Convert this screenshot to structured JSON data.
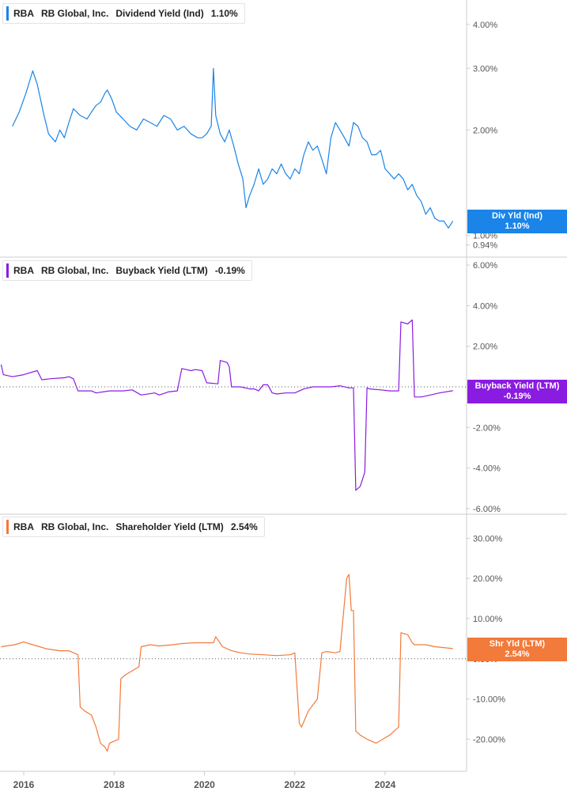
{
  "x_axis": {
    "ticks": [
      "2016",
      "2018",
      "2020",
      "2022",
      "2024"
    ]
  },
  "colors": {
    "dividend": "#1a84e8",
    "buyback": "#8a1be0",
    "shareholder": "#f27a3a",
    "axis_text": "#555555",
    "grid": "#cccccc"
  },
  "chart_data": [
    {
      "type": "line",
      "id": "dividend",
      "legend": {
        "ticker": "RBA",
        "company": "RB Global, Inc.",
        "metric": "Dividend Yield (Ind)",
        "value": "1.10%"
      },
      "tag": {
        "label": "Div Yld (Ind)",
        "value": "1.10%"
      },
      "y_scale": "log",
      "ylim": [
        0.9,
        4.6
      ],
      "y_ticks": [
        "4.00%",
        "3.00%",
        "2.00%",
        "1.00%",
        "0.94%"
      ],
      "y_tick_values": [
        4.0,
        3.0,
        2.0,
        1.0,
        0.94
      ],
      "series": [
        {
          "x": [
            2015.75,
            2015.9,
            2016.05,
            2016.2,
            2016.3,
            2016.45,
            2016.55,
            2016.7,
            2016.8,
            2016.9,
            2017.0,
            2017.1,
            2017.25,
            2017.4,
            2017.5,
            2017.6,
            2017.7,
            2017.8,
            2017.85,
            2017.95,
            2018.05,
            2018.2,
            2018.35,
            2018.5,
            2018.65,
            2018.8,
            2018.95,
            2019.1,
            2019.25,
            2019.4,
            2019.55,
            2019.7,
            2019.85,
            2019.95,
            2020.05,
            2020.15,
            2020.2,
            2020.25,
            2020.35,
            2020.45,
            2020.55,
            2020.65,
            2020.75,
            2020.85,
            2020.92,
            2021.0,
            2021.1,
            2021.2,
            2021.3,
            2021.4,
            2021.5,
            2021.6,
            2021.7,
            2021.8,
            2021.9,
            2022.0,
            2022.1,
            2022.2,
            2022.3,
            2022.4,
            2022.5,
            2022.6,
            2022.7,
            2022.8,
            2022.9,
            2023.0,
            2023.1,
            2023.2,
            2023.3,
            2023.4,
            2023.5,
            2023.6,
            2023.7,
            2023.8,
            2023.9,
            2024.0,
            2024.1,
            2024.2,
            2024.3,
            2024.4,
            2024.5,
            2024.6,
            2024.7,
            2024.8,
            2024.9,
            2025.0,
            2025.1,
            2025.2,
            2025.3,
            2025.4,
            2025.5
          ],
          "y": [
            2.05,
            2.25,
            2.55,
            2.95,
            2.7,
            2.2,
            1.95,
            1.85,
            2.0,
            1.9,
            2.1,
            2.3,
            2.2,
            2.15,
            2.25,
            2.35,
            2.4,
            2.55,
            2.6,
            2.45,
            2.25,
            2.15,
            2.05,
            2.0,
            2.15,
            2.1,
            2.05,
            2.2,
            2.15,
            2.0,
            2.05,
            1.95,
            1.9,
            1.9,
            1.95,
            2.05,
            3.0,
            2.2,
            1.95,
            1.85,
            2.0,
            1.8,
            1.6,
            1.45,
            1.2,
            1.3,
            1.4,
            1.55,
            1.4,
            1.45,
            1.55,
            1.5,
            1.6,
            1.5,
            1.45,
            1.55,
            1.5,
            1.7,
            1.85,
            1.75,
            1.8,
            1.65,
            1.5,
            1.9,
            2.1,
            2.0,
            1.9,
            1.8,
            2.1,
            2.05,
            1.9,
            1.85,
            1.7,
            1.7,
            1.75,
            1.55,
            1.5,
            1.45,
            1.5,
            1.45,
            1.35,
            1.4,
            1.3,
            1.25,
            1.15,
            1.2,
            1.12,
            1.1,
            1.1,
            1.05,
            1.1
          ]
        }
      ]
    },
    {
      "type": "line",
      "id": "buyback",
      "legend": {
        "ticker": "RBA",
        "company": "RB Global, Inc.",
        "metric": "Buyback Yield (LTM)",
        "value": "-0.19%"
      },
      "tag": {
        "label": "Buyback Yield (LTM)",
        "value": "-0.19%"
      },
      "y_scale": "linear",
      "ylim": [
        -6.2,
        6.2
      ],
      "y_ticks": [
        "6.00%",
        "4.00%",
        "2.00%",
        "-2.00%",
        "-4.00%",
        "-6.00%"
      ],
      "y_tick_values": [
        6,
        4,
        2,
        -2,
        -4,
        -6
      ],
      "zero_line": true,
      "series": [
        {
          "x": [
            2015.5,
            2015.55,
            2015.75,
            2016.0,
            2016.3,
            2016.4,
            2016.6,
            2016.9,
            2017.0,
            2017.1,
            2017.2,
            2017.5,
            2017.6,
            2017.9,
            2018.2,
            2018.4,
            2018.6,
            2018.9,
            2019.0,
            2019.2,
            2019.4,
            2019.5,
            2019.6,
            2019.7,
            2019.8,
            2019.95,
            2020.05,
            2020.3,
            2020.35,
            2020.5,
            2020.55,
            2020.6,
            2020.8,
            2021.0,
            2021.1,
            2021.2,
            2021.3,
            2021.4,
            2021.5,
            2021.6,
            2021.8,
            2022.0,
            2022.2,
            2022.4,
            2022.6,
            2022.8,
            2023.0,
            2023.2,
            2023.3,
            2023.35,
            2023.45,
            2023.55,
            2023.6,
            2023.65,
            2023.9,
            2024.1,
            2024.3,
            2024.35,
            2024.5,
            2024.6,
            2024.65,
            2024.8,
            2025.0,
            2025.2,
            2025.5
          ],
          "y": [
            1.1,
            0.6,
            0.5,
            0.6,
            0.8,
            0.35,
            0.4,
            0.45,
            0.5,
            0.4,
            -0.2,
            -0.2,
            -0.3,
            -0.2,
            -0.2,
            -0.15,
            -0.4,
            -0.3,
            -0.4,
            -0.25,
            -0.2,
            0.9,
            0.85,
            0.8,
            0.85,
            0.8,
            0.2,
            0.15,
            1.3,
            1.2,
            1.0,
            0.0,
            0.0,
            -0.1,
            -0.1,
            -0.2,
            0.1,
            0.1,
            -0.3,
            -0.35,
            -0.3,
            -0.3,
            -0.1,
            0.0,
            0.0,
            0.0,
            0.05,
            -0.05,
            -0.05,
            -5.1,
            -4.9,
            -4.2,
            -0.05,
            -0.1,
            -0.15,
            -0.2,
            -0.2,
            3.2,
            3.1,
            3.3,
            -0.5,
            -0.5,
            -0.4,
            -0.3,
            -0.19
          ]
        }
      ]
    },
    {
      "type": "line",
      "id": "shareholder",
      "legend": {
        "ticker": "RBA",
        "company": "RB Global, Inc.",
        "metric": "Shareholder Yield (LTM)",
        "value": "2.54%"
      },
      "tag": {
        "label": "Shr Yld (LTM)",
        "value": "2.54%"
      },
      "y_scale": "linear",
      "ylim": [
        -28,
        35
      ],
      "y_ticks": [
        "30.00%",
        "20.00%",
        "10.00%",
        "0.00%",
        "-10.00%",
        "-20.00%"
      ],
      "y_tick_values": [
        30,
        20,
        10,
        0,
        -10,
        -20
      ],
      "zero_line": true,
      "series": [
        {
          "x": [
            2015.5,
            2015.8,
            2016.0,
            2016.2,
            2016.5,
            2016.8,
            2017.0,
            2017.2,
            2017.25,
            2017.35,
            2017.5,
            2017.6,
            2017.7,
            2017.8,
            2017.85,
            2017.9,
            2018.1,
            2018.15,
            2018.25,
            2018.4,
            2018.55,
            2018.6,
            2018.8,
            2019.0,
            2019.3,
            2019.5,
            2019.8,
            2020.0,
            2020.2,
            2020.25,
            2020.4,
            2020.6,
            2020.8,
            2021.0,
            2021.3,
            2021.6,
            2021.9,
            2022.0,
            2022.1,
            2022.15,
            2022.3,
            2022.5,
            2022.6,
            2022.7,
            2022.9,
            2023.0,
            2023.15,
            2023.2,
            2023.25,
            2023.3,
            2023.35,
            2023.45,
            2023.6,
            2023.8,
            2023.95,
            2024.1,
            2024.3,
            2024.35,
            2024.5,
            2024.6,
            2024.65,
            2024.9,
            2025.1,
            2025.3,
            2025.5
          ],
          "y": [
            3.0,
            3.5,
            4.2,
            3.5,
            2.5,
            2.0,
            2.0,
            1.0,
            -12,
            -13,
            -14,
            -17,
            -21,
            -22,
            -23,
            -21,
            -20,
            -5,
            -4,
            -3,
            -2,
            3,
            3.5,
            3.2,
            3.5,
            3.8,
            4.0,
            4.0,
            4.0,
            5.5,
            3.0,
            2.0,
            1.5,
            1.2,
            1.0,
            0.8,
            1.0,
            1.5,
            -16,
            -17,
            -13,
            -10,
            1.5,
            1.8,
            1.5,
            1.8,
            20,
            21,
            12,
            12,
            -18,
            -19,
            -20,
            -21,
            -20,
            -19,
            -17,
            6.5,
            6.0,
            4.0,
            3.5,
            3.5,
            3.0,
            2.8,
            2.54
          ]
        }
      ]
    }
  ]
}
